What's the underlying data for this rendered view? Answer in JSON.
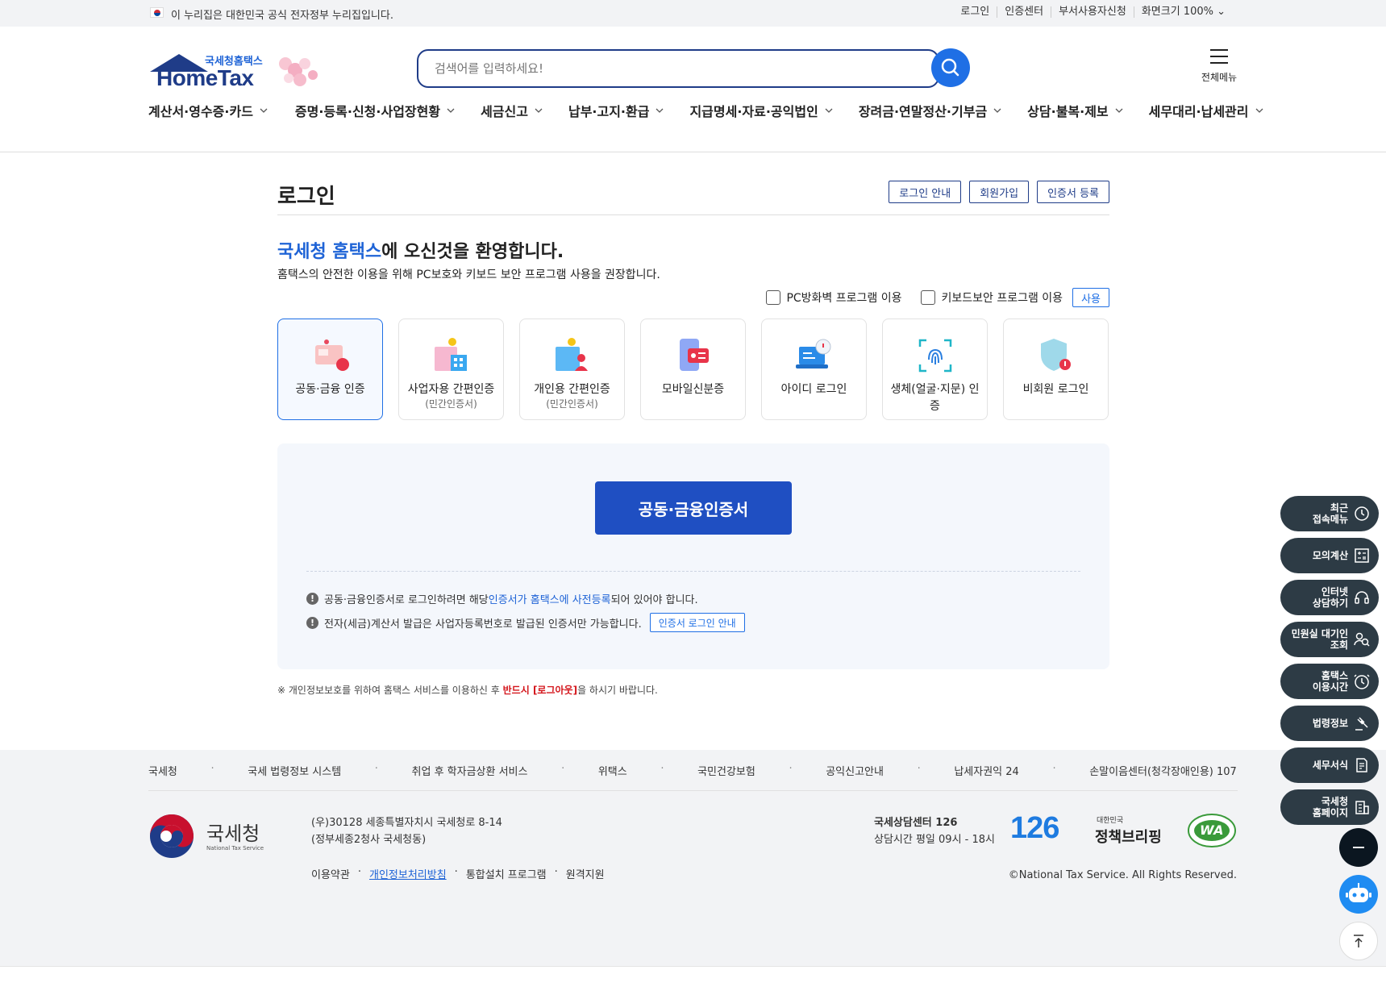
{
  "gov_bar": {
    "notice": "이 누리집은 대한민국 공식 전자정부 누리집입니다.",
    "links": [
      "로그인",
      "인증센터",
      "부서사용자신청",
      "화면크기 100%"
    ]
  },
  "header": {
    "logo_sub": "국세청홈택스",
    "logo_main": "HomeTax",
    "search_placeholder": "검색어를 입력하세요!",
    "all_menu_label": "전체메뉴",
    "nav": [
      "계산서·영수증·카드",
      "증명·등록·신청·사업장현황",
      "세금신고",
      "납부·고지·환급",
      "지급명세·자료·공익법인",
      "장려금·연말정산·기부금",
      "상담·불복·제보",
      "세무대리·납세관리"
    ]
  },
  "login": {
    "title": "로그인",
    "title_buttons": [
      "로그인 안내",
      "회원가입",
      "인증서 등록"
    ],
    "welcome_highlight": "국세청 홈택스",
    "welcome_rest": "에 오신것을 환영합니다.",
    "description": "홈택스의 안전한 이용을 위해 PC보호와 키보드 보안 프로그램 사용을 권장합니다.",
    "options": {
      "pc_firewall": "PC방화벽 프로그램 이용",
      "keyboard_security": "키보드보안 프로그램 이용",
      "use_button": "사용"
    },
    "methods": [
      {
        "label": "공동·금융 인증",
        "sub": "",
        "active": true
      },
      {
        "label": "사업자용 간편인증",
        "sub": "(민간인증서)",
        "active": false
      },
      {
        "label": "개인용 간편인증",
        "sub": "(민간인증서)",
        "active": false
      },
      {
        "label": "모바일신분증",
        "sub": "",
        "active": false
      },
      {
        "label": "아이디 로그인",
        "sub": "",
        "active": false
      },
      {
        "label": "생체(얼굴·지문) 인증",
        "sub": "",
        "active": false
      },
      {
        "label": "비회원 로그인",
        "sub": "",
        "active": false
      }
    ],
    "cert_button": "공동·금융인증서",
    "note1_pre": "공동·금융인증서로 로그인하려면 해당 ",
    "note1_link": "인증서가 홈택스에 사전등록",
    "note1_post": "되어 있어야 합니다.",
    "note2": "전자(세금)계산서 발급은 사업자등록번호로 발급된 인증서만 가능합니다.",
    "note2_button": "인증서 로그인 안내",
    "privacy_pre": "※ 개인정보보호를 위하여 홈택스 서비스를 이용하신 후 ",
    "privacy_red": "반드시 [로그아웃]",
    "privacy_post": "을 하시기 바랍니다."
  },
  "footer": {
    "links": [
      "국세청",
      "국세 법령정보 시스템",
      "취업 후 학자금상환 서비스",
      "위택스",
      "국민건강보험",
      "공익신고안내",
      "납세자권익 24",
      "손말이음센터(청각장애인용) 107"
    ],
    "logo_text": "국세청",
    "logo_en": "National Tax Service",
    "address_line1": "(우)30128 세종특별자치시 국세청로 8-14",
    "address_line2": "(정부세종2청사 국세청동)",
    "bottom_links": [
      "이용약관",
      "개인정보처리방침",
      "통합설치 프로그램",
      "원격지원"
    ],
    "center_title": "국세상담센터 126",
    "center_hours": "상담시간 평일 09시 - 18시",
    "badge_126": "126",
    "policy_small": "대한민국",
    "policy_big": "정책브리핑",
    "wa_text": "WA",
    "copyright": "©National Tax Service. All Rights Reserved."
  },
  "quick_menu": [
    "최근\n접속메뉴",
    "모의계산",
    "인터넷\n상담하기",
    "민원실 대기인\n조회",
    "홈택스\n이용시간",
    "법령정보",
    "세무서식",
    "국세청\n홈페이지"
  ],
  "colors": {
    "primary": "#1f4fc2",
    "accent_blue": "#1e63d6",
    "navy": "#1f3c88",
    "quick_bg": "#2d3b45",
    "warning_red": "#d4161c"
  }
}
